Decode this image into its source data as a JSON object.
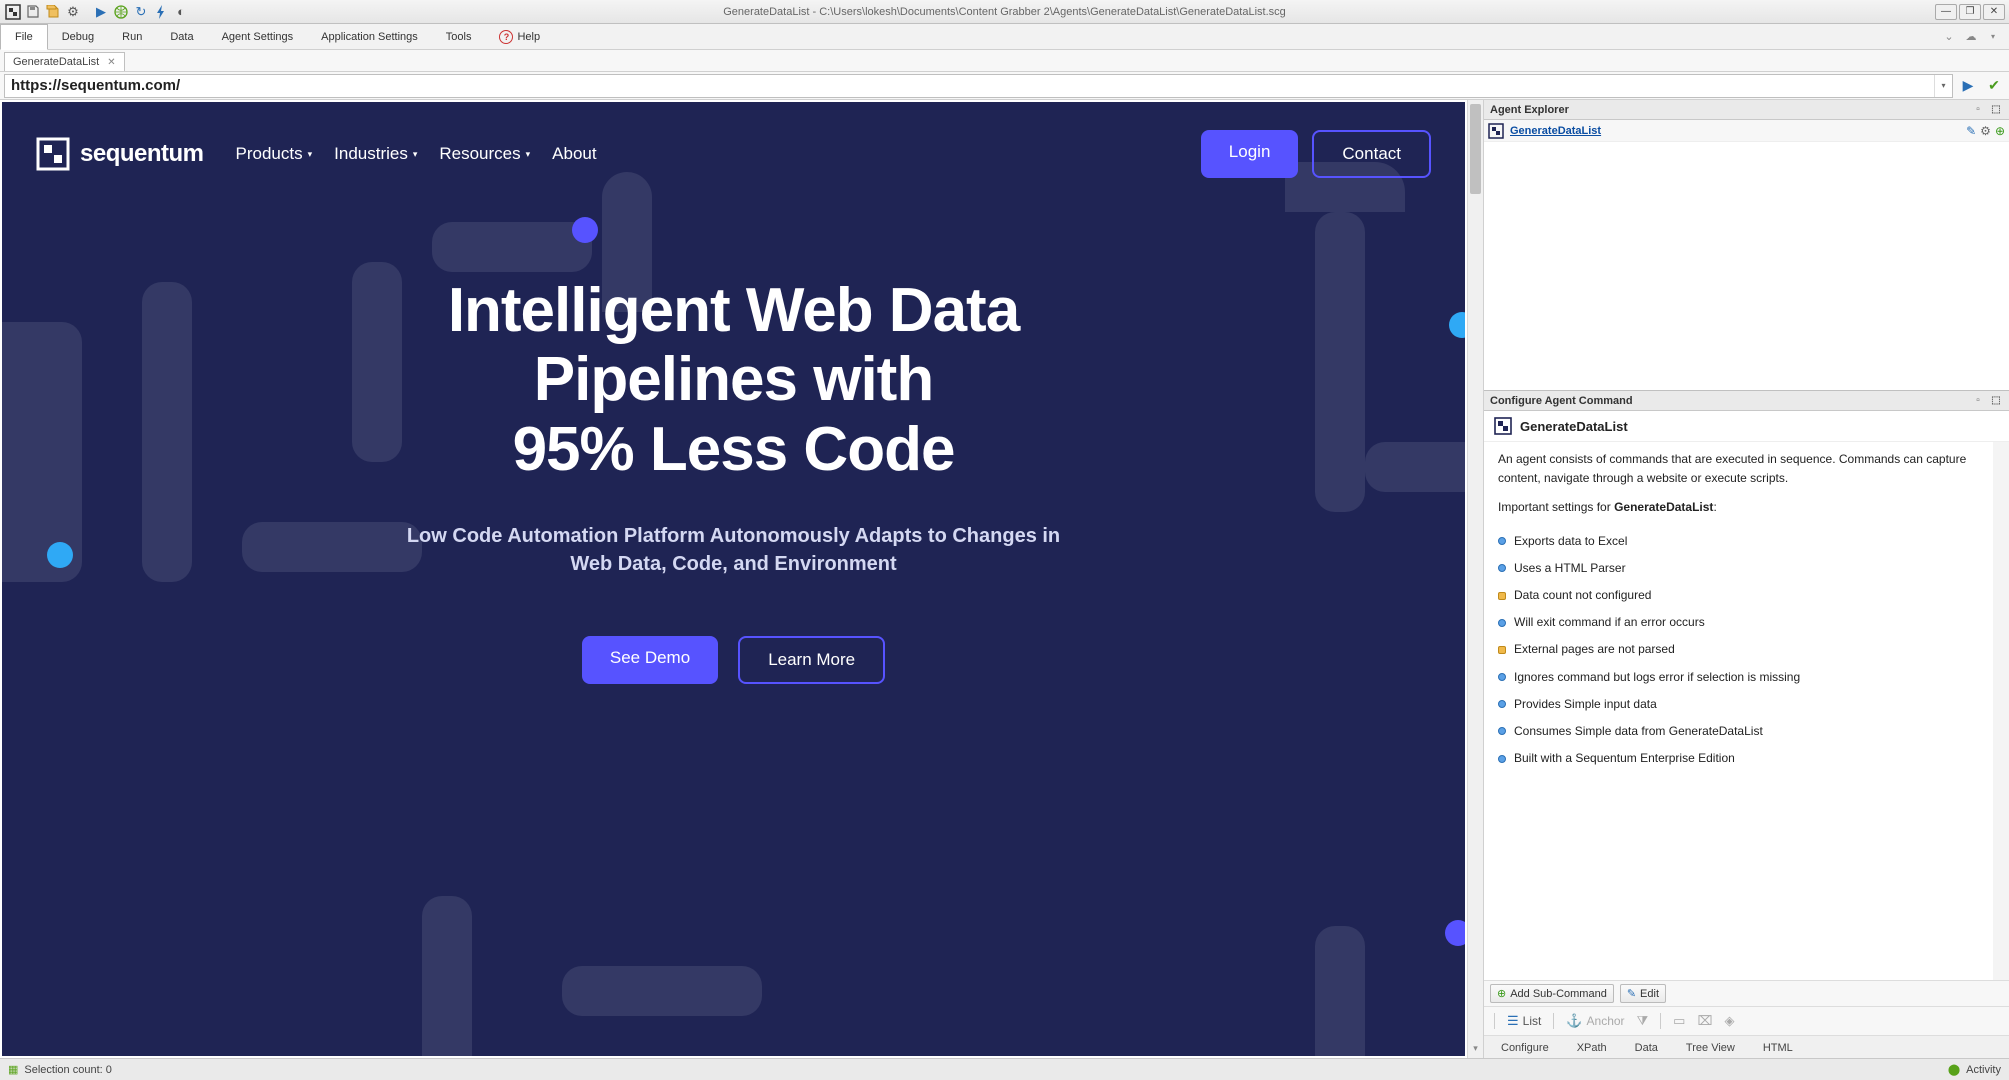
{
  "window": {
    "title": "GenerateDataList - C:\\Users\\lokesh\\Documents\\Content Grabber 2\\Agents\\GenerateDataList\\GenerateDataList.scg"
  },
  "menu": {
    "file": "File",
    "debug": "Debug",
    "run": "Run",
    "data": "Data",
    "agent_settings": "Agent Settings",
    "app_settings": "Application Settings",
    "tools": "Tools",
    "help": "Help"
  },
  "doc_tab": {
    "label": "GenerateDataList"
  },
  "address": "https://sequentum.com/",
  "page": {
    "brand": "sequentum",
    "nav": {
      "products": "Products",
      "industries": "Industries",
      "resources": "Resources",
      "about": "About"
    },
    "login": "Login",
    "contact": "Contact",
    "hero_line1": "Intelligent Web Data",
    "hero_line2": "Pipelines with",
    "hero_line3": "95% Less Code",
    "sub1": "Low Code Automation Platform Autonomously Adapts to Changes in",
    "sub2": "Web Data, Code, and Environment",
    "see_demo": "See Demo",
    "learn_more": "Learn More"
  },
  "explorer": {
    "title": "Agent Explorer",
    "agent": "GenerateDataList"
  },
  "configure": {
    "title": "Configure Agent Command",
    "agent": "GenerateDataList",
    "desc": "An agent consists of commands that are executed in sequence. Commands can capture content, navigate through a website or execute scripts.",
    "important_prefix": "Important settings for ",
    "important_name": "GenerateDataList",
    "important_suffix": ":",
    "items": [
      {
        "kind": "blue",
        "text": "Exports data to Excel"
      },
      {
        "kind": "blue",
        "text": "Uses a HTML Parser"
      },
      {
        "kind": "orange",
        "text": "Data count not configured"
      },
      {
        "kind": "blue",
        "text": "Will exit command if an error occurs"
      },
      {
        "kind": "orange",
        "text": "External pages are not parsed"
      },
      {
        "kind": "blue",
        "text": "Ignores command but logs error if selection is missing"
      },
      {
        "kind": "blue",
        "text": "Provides Simple input data"
      },
      {
        "kind": "blue",
        "text": "Consumes Simple data from GenerateDataList"
      },
      {
        "kind": "blue",
        "text": "Built with a Sequentum Enterprise Edition"
      }
    ],
    "add_sub": "Add Sub-Command",
    "edit": "Edit",
    "tb_list": "List",
    "tb_anchor": "Anchor",
    "tabs": {
      "configure": "Configure",
      "xpath": "XPath",
      "data": "Data",
      "tree": "Tree View",
      "html": "HTML"
    }
  },
  "status": {
    "selection": "Selection count: 0",
    "activity": "Activity"
  }
}
